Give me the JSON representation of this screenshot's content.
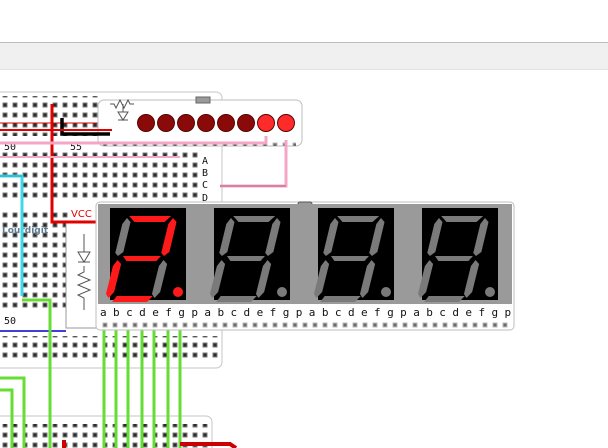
{
  "app": {
    "name": "breadboard-circuit-simulator",
    "canvas_background": "#ffffff"
  },
  "breadboard": {
    "row_numbers": [
      "50",
      "55",
      "50"
    ],
    "row_letters": [
      "A",
      "B",
      "C",
      "D"
    ],
    "part_tag": "Lourdigit"
  },
  "led_bar": {
    "led_count": 8,
    "lit_color": "#ff2a2a",
    "dim_color": "#8a0a0a",
    "led_levels": [
      0,
      0,
      0,
      0,
      0,
      0,
      1,
      1
    ]
  },
  "resistor_block": {
    "supply_label": "VCC"
  },
  "seven_segment_display": {
    "digit_count": 4,
    "segment_on_color": "#ff1a1a",
    "segment_off_color": "#7a7a7a",
    "body_color": "#000000",
    "pin_labels": [
      "a",
      "b",
      "c",
      "d",
      "e",
      "f",
      "g",
      "p",
      "a",
      "b",
      "c",
      "d",
      "e",
      "f",
      "g",
      "p",
      "a",
      "b",
      "c",
      "d",
      "e",
      "f",
      "g",
      "p",
      "a",
      "b",
      "c",
      "d",
      "e",
      "f",
      "g",
      "p"
    ],
    "digits": [
      {
        "index": 1,
        "segments_on": [
          "a",
          "b",
          "d",
          "e",
          "g"
        ],
        "dp": true
      },
      {
        "index": 2,
        "segments_on": [],
        "dp": false
      },
      {
        "index": 3,
        "segments_on": [],
        "dp": false
      },
      {
        "index": 4,
        "segments_on": [],
        "dp": false
      }
    ]
  },
  "wires": {
    "colors": {
      "red": "#e00000",
      "black": "#000000",
      "pink": "#f4a6c4",
      "cyan": "#3fd8e8",
      "green": "#66dd33",
      "blue": "#0000cc",
      "dark_red": "#cc0000"
    }
  }
}
